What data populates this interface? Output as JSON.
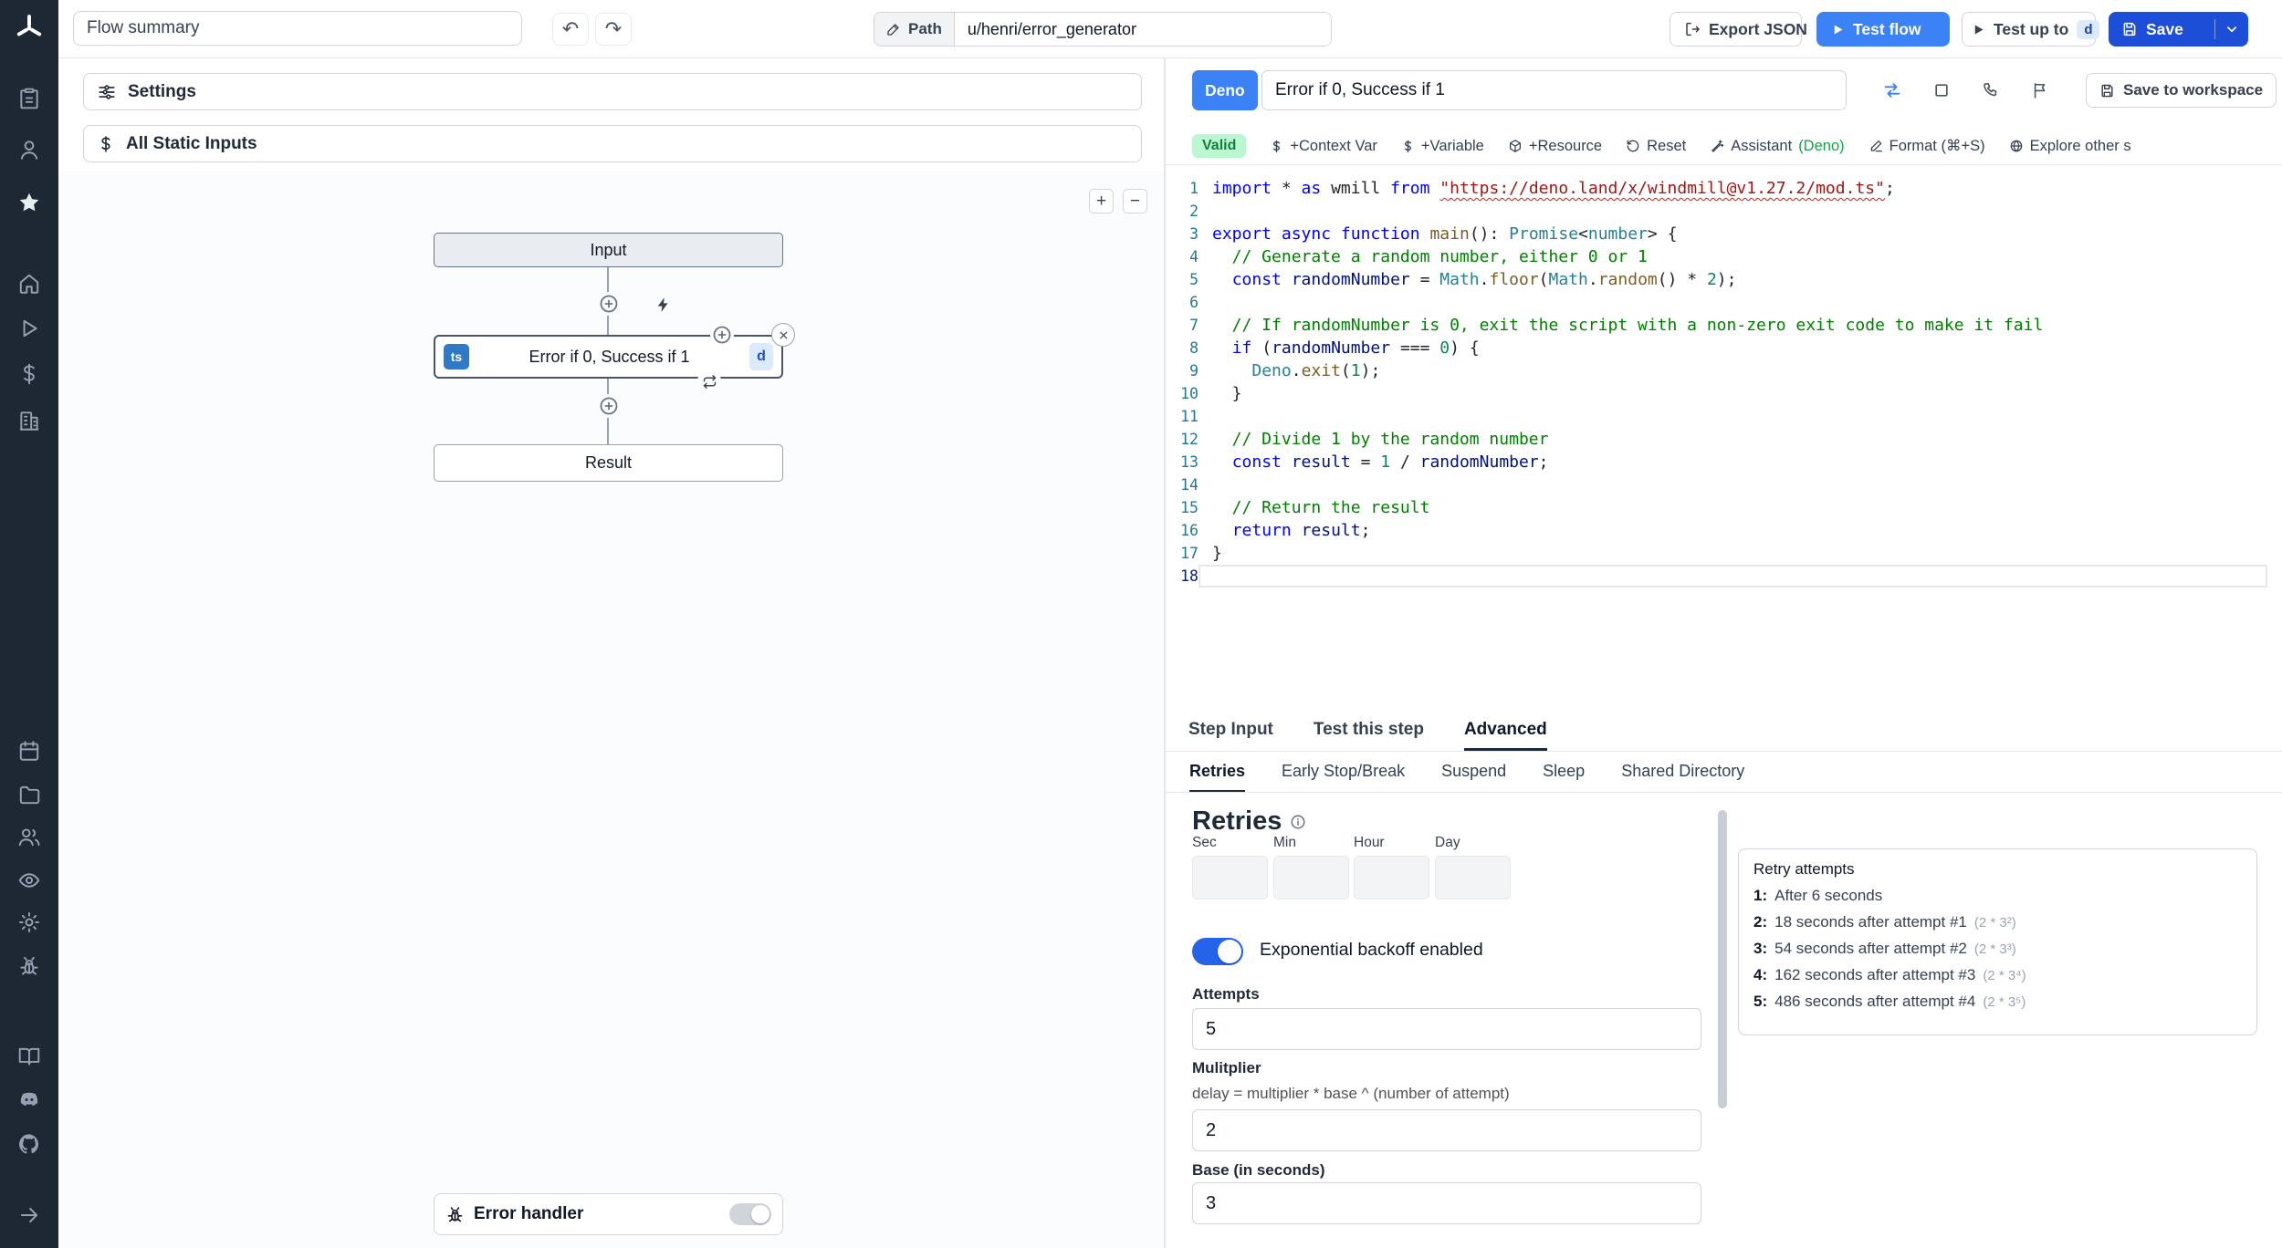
{
  "icons": {
    "undo": "↶",
    "redo": "↷",
    "zoom_in": "+",
    "zoom_out": "−"
  },
  "topbar": {
    "flow_summary": "Flow summary",
    "path_label": "Path",
    "path_value": "u/henri/error_generator",
    "export_json_label": "Export JSON",
    "test_flow_label": "Test flow",
    "test_up_to_label": "Test up to",
    "test_up_to_step": "d",
    "save_label": "Save"
  },
  "flow": {
    "settings_label": "Settings",
    "static_inputs_label": "All Static Inputs",
    "input_node": "Input",
    "step_node": {
      "lang": "ts",
      "label": "Error if 0, Success if 1",
      "id": "d"
    },
    "result_node": "Result",
    "error_handler_label": "Error handler"
  },
  "editor": {
    "lang_badge": "Deno",
    "title": "Error if 0, Success if 1",
    "save_to_workspace": "Save to workspace",
    "validity": "Valid",
    "toolbar": {
      "context_var": "+Context Var",
      "variable": "+Variable",
      "resource": "+Resource",
      "reset": "Reset",
      "assistant": "Assistant",
      "assistant_mode": "(Deno)",
      "format": "Format (⌘+S)",
      "explore": "Explore other s"
    },
    "code": [
      {
        "t": [
          [
            "kw",
            "import"
          ],
          [
            "pl",
            " * "
          ],
          [
            "kw",
            "as"
          ],
          [
            "pl",
            " wmill "
          ],
          [
            "kw",
            "from"
          ],
          [
            "pl",
            " "
          ],
          [
            "str err",
            "\"https://deno.land/x/windmill@v1.27.2/mod.ts\""
          ],
          [
            "pl",
            ";"
          ]
        ]
      },
      {
        "t": []
      },
      {
        "t": [
          [
            "kw",
            "export"
          ],
          [
            "pl",
            " "
          ],
          [
            "kw",
            "async"
          ],
          [
            "pl",
            " "
          ],
          [
            "kw",
            "function"
          ],
          [
            "pl",
            " "
          ],
          [
            "fn",
            "main"
          ],
          [
            "pl",
            "(): "
          ],
          [
            "type",
            "Promise"
          ],
          [
            "pl",
            "<"
          ],
          [
            "type",
            "number"
          ],
          [
            "pl",
            "> {"
          ]
        ]
      },
      {
        "t": [
          [
            "cm",
            "  // Generate a random number, either 0 or 1"
          ]
        ]
      },
      {
        "t": [
          [
            "pl",
            "  "
          ],
          [
            "kw",
            "const"
          ],
          [
            "pl",
            " "
          ],
          [
            "var",
            "randomNumber"
          ],
          [
            "pl",
            " = "
          ],
          [
            "type",
            "Math"
          ],
          [
            "pl",
            "."
          ],
          [
            "fn",
            "floor"
          ],
          [
            "pl",
            "("
          ],
          [
            "type",
            "Math"
          ],
          [
            "pl",
            "."
          ],
          [
            "fn",
            "random"
          ],
          [
            "pl",
            "() * "
          ],
          [
            "num",
            "2"
          ],
          [
            "pl",
            ");"
          ]
        ]
      },
      {
        "t": []
      },
      {
        "t": [
          [
            "cm",
            "  // If randomNumber is 0, exit the script with a non-zero exit code to make it fail"
          ]
        ]
      },
      {
        "t": [
          [
            "pl",
            "  "
          ],
          [
            "kw",
            "if"
          ],
          [
            "pl",
            " ("
          ],
          [
            "var",
            "randomNumber"
          ],
          [
            "pl",
            " === "
          ],
          [
            "num",
            "0"
          ],
          [
            "pl",
            ") {"
          ]
        ]
      },
      {
        "t": [
          [
            "pl",
            "    "
          ],
          [
            "type",
            "Deno"
          ],
          [
            "pl",
            "."
          ],
          [
            "fn",
            "exit"
          ],
          [
            "pl",
            "("
          ],
          [
            "num",
            "1"
          ],
          [
            "pl",
            ");"
          ]
        ]
      },
      {
        "t": [
          [
            "pl",
            "  }"
          ]
        ]
      },
      {
        "t": []
      },
      {
        "t": [
          [
            "cm",
            "  // Divide 1 by the random number"
          ]
        ]
      },
      {
        "t": [
          [
            "pl",
            "  "
          ],
          [
            "kw",
            "const"
          ],
          [
            "pl",
            " "
          ],
          [
            "var",
            "result"
          ],
          [
            "pl",
            " = "
          ],
          [
            "num",
            "1"
          ],
          [
            "pl",
            " / "
          ],
          [
            "var",
            "randomNumber"
          ],
          [
            "pl",
            ";"
          ]
        ]
      },
      {
        "t": []
      },
      {
        "t": [
          [
            "cm",
            "  // Return the result"
          ]
        ]
      },
      {
        "t": [
          [
            "pl",
            "  "
          ],
          [
            "kw",
            "return"
          ],
          [
            "pl",
            " "
          ],
          [
            "var",
            "result"
          ],
          [
            "pl",
            ";"
          ]
        ]
      },
      {
        "t": [
          [
            "pl",
            "}"
          ]
        ]
      },
      {
        "t": [],
        "current": true
      }
    ]
  },
  "panel": {
    "tabs": [
      "Step Input",
      "Test this step",
      "Advanced"
    ],
    "subtabs": [
      "Retries",
      "Early Stop/Break",
      "Suspend",
      "Sleep",
      "Shared Directory"
    ],
    "retries": {
      "heading": "Retries",
      "time_units": [
        "Sec",
        "Min",
        "Hour",
        "Day"
      ],
      "backoff_label": "Exponential backoff enabled",
      "attempts_label": "Attempts",
      "attempts_value": "5",
      "multiplier_label": "Mulitplier",
      "multiplier_help": "delay = multiplier * base ^ (number of attempt)",
      "multiplier_value": "2",
      "base_label": "Base (in seconds)",
      "base_value": "3"
    },
    "retry_box": {
      "title": "Retry attempts",
      "items": [
        {
          "n": "1:",
          "text": "After 6 seconds",
          "formula": ""
        },
        {
          "n": "2:",
          "text": "18 seconds after attempt #1",
          "formula": "(2 * 3²)"
        },
        {
          "n": "3:",
          "text": "54 seconds after attempt #2",
          "formula": "(2 * 3³)"
        },
        {
          "n": "4:",
          "text": "162 seconds after attempt #3",
          "formula": "(2 * 3⁴)"
        },
        {
          "n": "5:",
          "text": "486 seconds after attempt #4",
          "formula": "(2 * 3⁵)"
        }
      ]
    }
  }
}
